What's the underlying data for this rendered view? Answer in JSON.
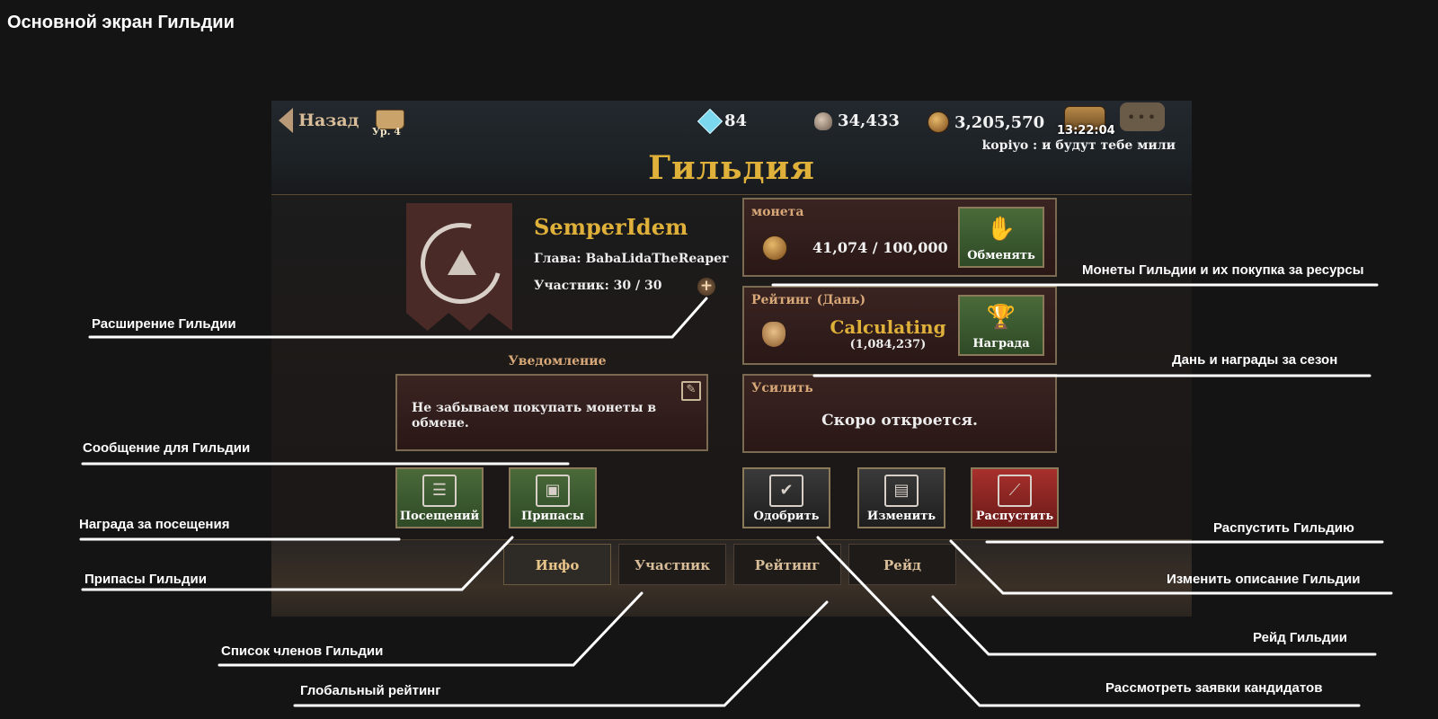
{
  "page_title": "Основной экран Гильдии",
  "game": {
    "back_label": "Назад",
    "level_label": "Ур. 4",
    "gems": "84",
    "skulls": "34,433",
    "gold": "3,205,570",
    "chest_timer": "13:22:04",
    "chat_message": "kopiyo : и будут тебе мили",
    "title": "Гильдия",
    "guild": {
      "name": "SemperIdem",
      "leader": "Глава: BabaLidaTheReaper",
      "members": "Участник: 30 / 30"
    },
    "notice": {
      "label": "Уведомление",
      "text": "Не забываем покупать монеты в обмене."
    },
    "coin_panel": {
      "label": "монета",
      "count": "41,074 / 100,000",
      "button": "Обменять"
    },
    "rank_panel": {
      "label": "Рейтинг (Дань)",
      "status": "Calculating",
      "value": "(1,084,237)",
      "button": "Награда"
    },
    "boost_panel": {
      "label": "Усилить",
      "text": "Скоро откроется."
    },
    "actions": {
      "attendance": "Посещений",
      "supplies": "Припасы",
      "approve": "Одобрить",
      "edit": "Изменить",
      "disband": "Распустить"
    },
    "tabs": [
      "Инфо",
      "Участник",
      "Рейтинг",
      "Рейд"
    ]
  },
  "annotations": {
    "expand": "Расширение Гильдии",
    "message": "Сообщение для Гильдии",
    "attendance": "Награда за посещения",
    "supplies": "Припасы Гильдии",
    "members_list": "Список членов Гильдии",
    "global_rank": "Глобальный рейтинг",
    "coins": "Монеты Гильдии и их покупка за ресурсы",
    "tribute": "Дань и награды за сезон",
    "disband": "Распустить Гильдию",
    "edit_desc": "Изменить описание Гильдии",
    "raid": "Рейд Гильдии",
    "applications": "Рассмотреть заявки кандидатов"
  },
  "colors": {
    "gold_title": "#e0b13a",
    "panel_label": "#d8a878",
    "green_button": "#3a5a30",
    "red_button": "#8a2420"
  }
}
